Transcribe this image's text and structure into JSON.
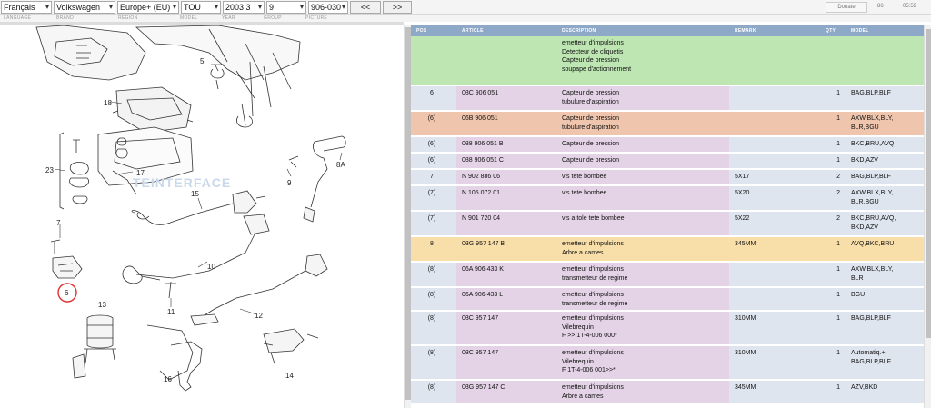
{
  "toolbar": {
    "language": "Français",
    "brand": "Volkswagen",
    "region": "Europe+ (EU)",
    "model": "TOU",
    "year": "2003",
    "year_sub": "3",
    "group": "9",
    "picture": "906-030",
    "prev_label": "<<",
    "next_label": ">>",
    "donate_label": "Donate",
    "counter": "86",
    "time": "05:59"
  },
  "toolbar_labels": {
    "language": "LANGUAGE",
    "brand": "BRAND",
    "region": "REGION",
    "model": "MODEL",
    "year": "YEAR",
    "group": "GROUP",
    "picture": "PICTURE"
  },
  "diagram": {
    "watermark": "TEINTERFACE",
    "callouts": [
      "5",
      "18",
      "23",
      "17",
      "15",
      "9",
      "8A",
      "7",
      "6",
      "10",
      "13",
      "11",
      "12",
      "16",
      "14"
    ]
  },
  "table": {
    "headers": [
      "POS",
      "ARTICLE",
      "DESCRIPTION",
      "REMARK",
      "QTY",
      "MODEL"
    ],
    "rows": [
      {
        "pos": "",
        "article": "",
        "description": [
          "emetteur d'impulsions",
          "Detecteur de cliquetis",
          "Capteur de pression",
          "soupape d'actionnement"
        ],
        "remark": "",
        "qty": "",
        "model": [],
        "color": "green"
      },
      {
        "pos": "6",
        "article": "03C 906 051",
        "description": [
          "Capteur de pression",
          "tubulure d'aspiration"
        ],
        "remark": "",
        "qty": "1",
        "model": [
          "BAG,BLP,BLF"
        ],
        "color": ""
      },
      {
        "pos": "(6)",
        "article": "06B 906 051",
        "description": [
          "Capteur de pression",
          "tubulure d'aspiration"
        ],
        "remark": "",
        "qty": "1",
        "model": [
          "AXW,BLX,BLY,",
          "BLR,BGU"
        ],
        "color": "orange"
      },
      {
        "pos": "(6)",
        "article": "038 906 051 B",
        "description": [
          "Capteur de pression"
        ],
        "remark": "",
        "qty": "1",
        "model": [
          "BKC,BRU,AVQ"
        ],
        "color": ""
      },
      {
        "pos": "(6)",
        "article": "038 906 051 C",
        "description": [
          "Capteur de pression"
        ],
        "remark": "",
        "qty": "1",
        "model": [
          "BKD,AZV"
        ],
        "color": ""
      },
      {
        "pos": "7",
        "article": "N   902 886 06",
        "description": [
          "vis tete bombee"
        ],
        "remark": "5X17",
        "qty": "2",
        "model": [
          "BAG,BLP,BLF"
        ],
        "color": ""
      },
      {
        "pos": "(7)",
        "article": "N   105 072 01",
        "description": [
          "vis tete bombee"
        ],
        "remark": "5X20",
        "qty": "2",
        "model": [
          "AXW,BLX,BLY,",
          "BLR,BGU"
        ],
        "color": ""
      },
      {
        "pos": "(7)",
        "article": "N   901 720 04",
        "description": [
          "vis a tole tete bombee"
        ],
        "remark": "5X22",
        "qty": "2",
        "model": [
          "BKC,BRU,AVQ,",
          "BKD,AZV"
        ],
        "color": ""
      },
      {
        "pos": "8",
        "article": "03G 957 147 B",
        "description": [
          "emetteur d'impulsions",
          "Arbre a cames"
        ],
        "remark": "345MM",
        "qty": "1",
        "model": [
          "AVQ,BKC,BRU"
        ],
        "color": "yellow"
      },
      {
        "pos": "(8)",
        "article": "06A 906 433 K",
        "description": [
          "emetteur d'impulsions",
          "transmetteur de regime"
        ],
        "remark": "",
        "qty": "1",
        "model": [
          "AXW,BLX,BLY,",
          "BLR"
        ],
        "color": ""
      },
      {
        "pos": "(8)",
        "article": "06A 906 433 L",
        "description": [
          "emetteur d'impulsions",
          "transmetteur de regime"
        ],
        "remark": "",
        "qty": "1",
        "model": [
          "BGU"
        ],
        "color": ""
      },
      {
        "pos": "(8)",
        "article": "03C 957 147",
        "description": [
          "emetteur d'impulsions",
          "Vilebrequin",
          "F        >> 1T-4-006 000*"
        ],
        "remark": "310MM",
        "qty": "1",
        "model": [
          "BAG,BLP,BLF"
        ],
        "color": ""
      },
      {
        "pos": "(8)",
        "article": "03C 957 147",
        "description": [
          "emetteur d'impulsions",
          "Vilebrequin",
          "F 1T-4-006 001>>*"
        ],
        "remark": "310MM",
        "qty": "1",
        "model": [
          "Automatiq.+",
          "BAG,BLP,BLF"
        ],
        "color": ""
      },
      {
        "pos": "(8)",
        "article": "03G 957 147 C",
        "description": [
          "emetteur d'impulsions",
          "Arbre a cames"
        ],
        "remark": "345MM",
        "qty": "1",
        "model": [
          "AZV,BKD"
        ],
        "color": ""
      }
    ]
  }
}
